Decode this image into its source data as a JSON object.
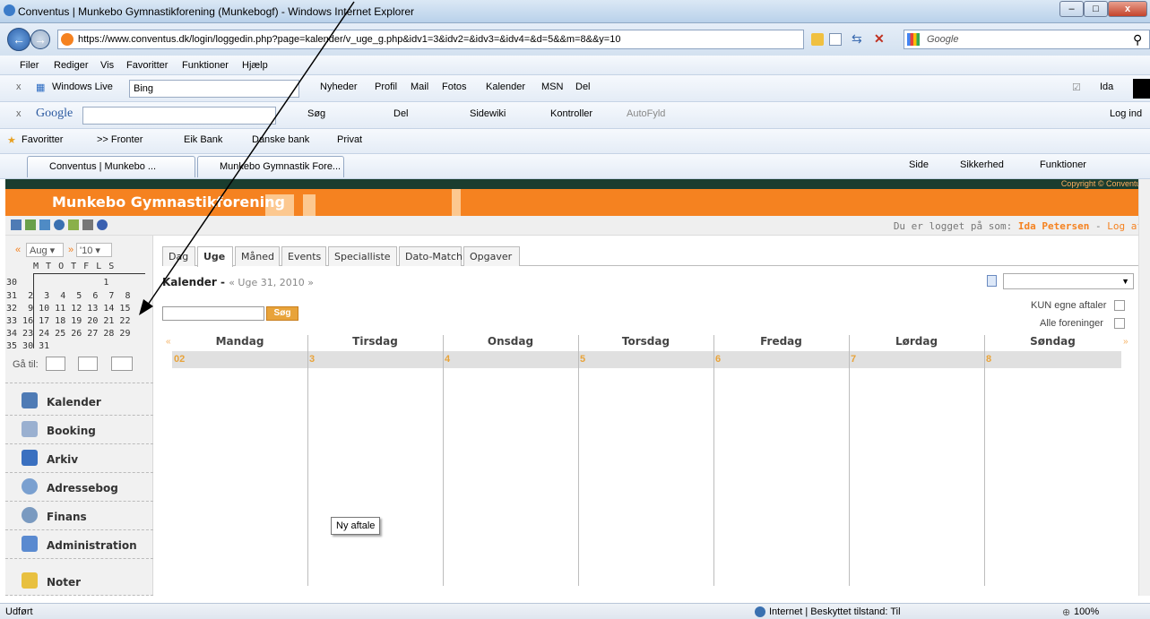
{
  "window": {
    "title": "Conventus | Munkebo Gymnastikforening (Munkebogf) - Windows Internet Explorer"
  },
  "address": {
    "url": "https://www.conventus.dk/login/loggedin.php?page=kalender/v_uge_g.php&idv1=3&idv2=&idv3=&idv4=&d=5&&m=8&&y=10",
    "search_placeholder": "Google"
  },
  "menu": [
    "Filer",
    "Rediger",
    "Vis",
    "Favoritter",
    "Funktioner",
    "Hjælp"
  ],
  "wl_toolbar": {
    "brand": "Windows Live",
    "search_value": "Bing",
    "links": [
      "Nyheder",
      "Profil",
      "Mail",
      "Fotos",
      "Kalender",
      "MSN",
      "Del"
    ],
    "user": "Ida"
  },
  "google_toolbar": {
    "brand": "Google",
    "search_label": "Søg",
    "share_label": "Del",
    "sidewiki_label": "Sidewiki",
    "kontroller_label": "Kontroller",
    "autofyld_label": "AutoFyld",
    "login_label": "Log ind"
  },
  "fav_bar": {
    "favorites": "Favoritter",
    "items": [
      ">> Fronter",
      "Eik Bank",
      "Danske bank",
      "Privat"
    ]
  },
  "tabs": [
    "Conventus | Munkebo ...",
    "Munkebo Gymnastik Fore..."
  ],
  "ie_commands": [
    "Side",
    "Sikkerhed",
    "Funktioner"
  ],
  "site": {
    "name": "Munkebo Gymnastikforening",
    "copyright": "Copyright © Conventus",
    "logged_in_prefix": "Du er logget på som:",
    "user_name": "Ida Petersen",
    "logout": "Log af"
  },
  "minical": {
    "month": "Aug",
    "year": "'10",
    "weekdays": "M T O T F L S",
    "rows": [
      "30                1",
      "31  2  3  4  5  6  7  8",
      "32  9 10 11 12 13 14 15",
      "33 16 17 18 19 20 21 22",
      "34 23 24 25 26 27 28 29",
      "35 30 31"
    ],
    "goto_label": "Gå til:"
  },
  "sidebar": {
    "items": [
      "Kalender",
      "Booking",
      "Arkiv",
      "Adressebog",
      "Finans",
      "Administration",
      "Noter"
    ]
  },
  "page_tabs": [
    "Dag",
    "Uge",
    "Måned",
    "Events",
    "Specialliste",
    "Dato-Match",
    "Opgaver"
  ],
  "calendar": {
    "title": "Kalender",
    "week_label": "« Uge 31, 2010 »",
    "search_button": "Søg",
    "only_own": "KUN egne aftaler",
    "all_assoc": "Alle foreninger",
    "days": [
      "Mandag",
      "Tirsdag",
      "Onsdag",
      "Torsdag",
      "Fredag",
      "Lørdag",
      "Søndag"
    ],
    "dates": [
      "02",
      "3",
      "4",
      "5",
      "6",
      "7",
      "8"
    ],
    "tooltip": "Ny aftale"
  },
  "status": {
    "left": "Udført",
    "zone": "Internet | Beskyttet tilstand: Til",
    "zoom": "100%"
  }
}
